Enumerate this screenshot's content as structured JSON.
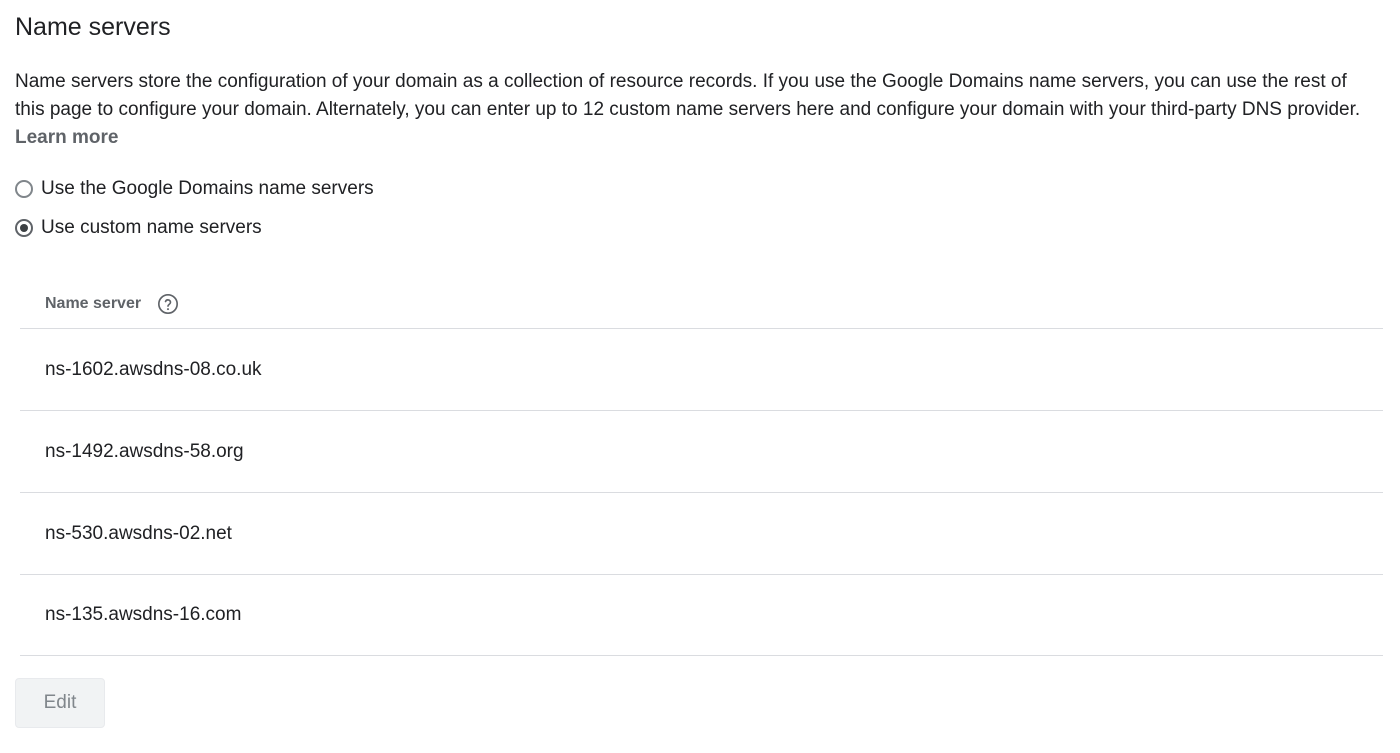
{
  "section": {
    "title": "Name servers",
    "description": "Name servers store the configuration of your domain as a collection of resource records. If you use the Google Domains name servers, you can use the rest of this page to configure your domain. Alternately, you can enter up to 12 custom name servers here and configure your domain with your third-party DNS provider.",
    "learn_more": "Learn more"
  },
  "options": [
    {
      "label": "Use the Google Domains name servers",
      "selected": false
    },
    {
      "label": "Use custom name servers",
      "selected": true
    }
  ],
  "table": {
    "header": "Name server",
    "help_icon": "help-circle-icon",
    "rows": [
      "ns-1602.awsdns-08.co.uk",
      "ns-1492.awsdns-58.org",
      "ns-530.awsdns-02.net",
      "ns-135.awsdns-16.com"
    ]
  },
  "actions": {
    "edit_label": "Edit"
  },
  "colors": {
    "text": "#202124",
    "muted": "#5f6368",
    "divider": "#dadce0",
    "button_bg": "#f1f3f4"
  }
}
